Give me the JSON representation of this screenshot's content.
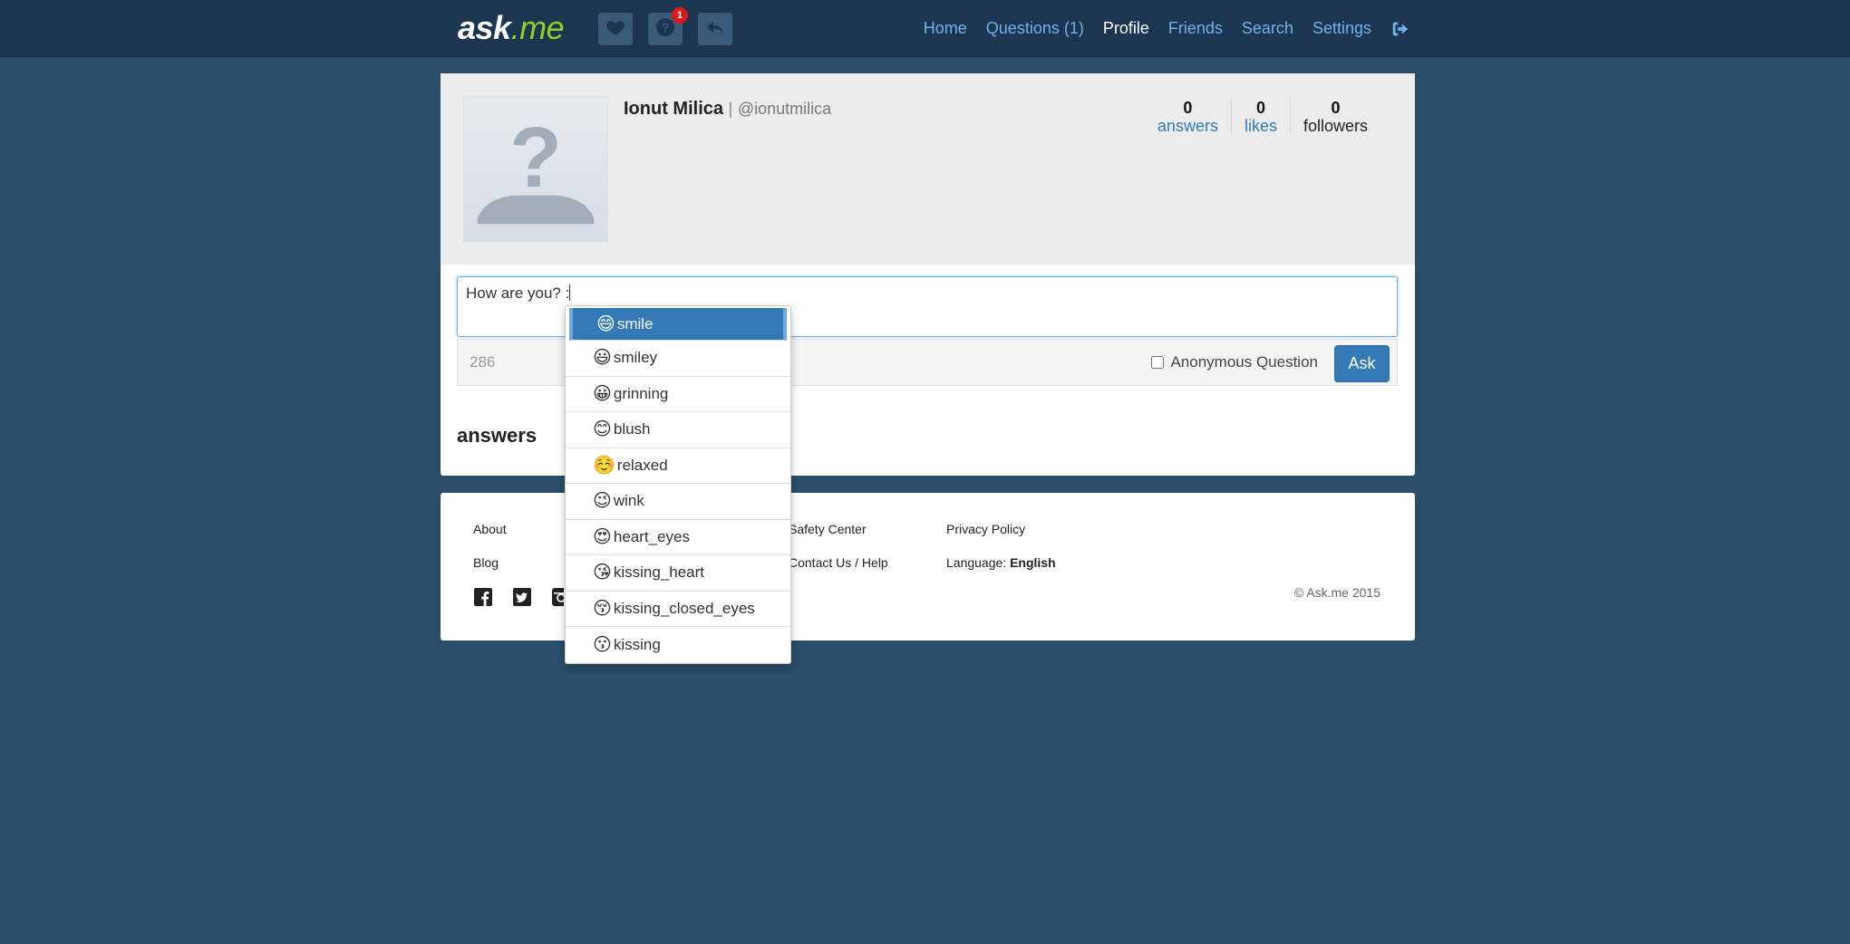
{
  "navbar": {
    "logo_main": "ask",
    "logo_suffix": ".me",
    "notification_count": "1",
    "links": [
      {
        "label": "Home"
      },
      {
        "label": "Questions (1)"
      },
      {
        "label": "Profile"
      },
      {
        "label": "Friends"
      },
      {
        "label": "Search"
      },
      {
        "label": "Settings"
      }
    ],
    "active_link": "Profile",
    "icons": [
      "heart-icon",
      "question-icon",
      "reply-icon",
      "logout-icon"
    ]
  },
  "profile": {
    "name": "Ionut Milica",
    "separator": "|",
    "handle": "@ionutmilica",
    "stats": [
      {
        "value": "0",
        "label": "answers"
      },
      {
        "value": "0",
        "label": "likes"
      },
      {
        "value": "0",
        "label": "followers"
      }
    ]
  },
  "ask": {
    "text": "How are you? :",
    "char_count": "286",
    "anonymous_label": "Anonymous Question",
    "anonymous_checked": false,
    "button": "Ask"
  },
  "answers_heading": "answers",
  "emoji_menu": {
    "items": [
      {
        "name": "smile",
        "glyph": "😄"
      },
      {
        "name": "smiley",
        "glyph": "😃"
      },
      {
        "name": "grinning",
        "glyph": "😀"
      },
      {
        "name": "blush",
        "glyph": "😊"
      },
      {
        "name": "relaxed",
        "glyph": "☺️"
      },
      {
        "name": "wink",
        "glyph": "😉"
      },
      {
        "name": "heart_eyes",
        "glyph": "😍"
      },
      {
        "name": "kissing_heart",
        "glyph": "😘"
      },
      {
        "name": "kissing_closed_eyes",
        "glyph": "😚"
      },
      {
        "name": "kissing",
        "glyph": "😗"
      }
    ],
    "selected": "smile"
  },
  "footer": {
    "about": "About",
    "blog": "Blog",
    "safety_center": "Safety Center",
    "contact": "Contact Us / Help",
    "privacy": "Privacy Policy",
    "language_label": "Language:",
    "language_value": "English",
    "copyright": "© Ask.me 2015",
    "social_icons": [
      "facebook-icon",
      "twitter-icon",
      "instagram-icon"
    ]
  },
  "colors": {
    "page_bg": "#2a4d6a",
    "navbar_bg": "#1c3550",
    "link_blue": "#337ab7",
    "nav_link": "#6fb4e8",
    "logo_accent": "#8fd12b",
    "badge_red": "#e0181b"
  }
}
